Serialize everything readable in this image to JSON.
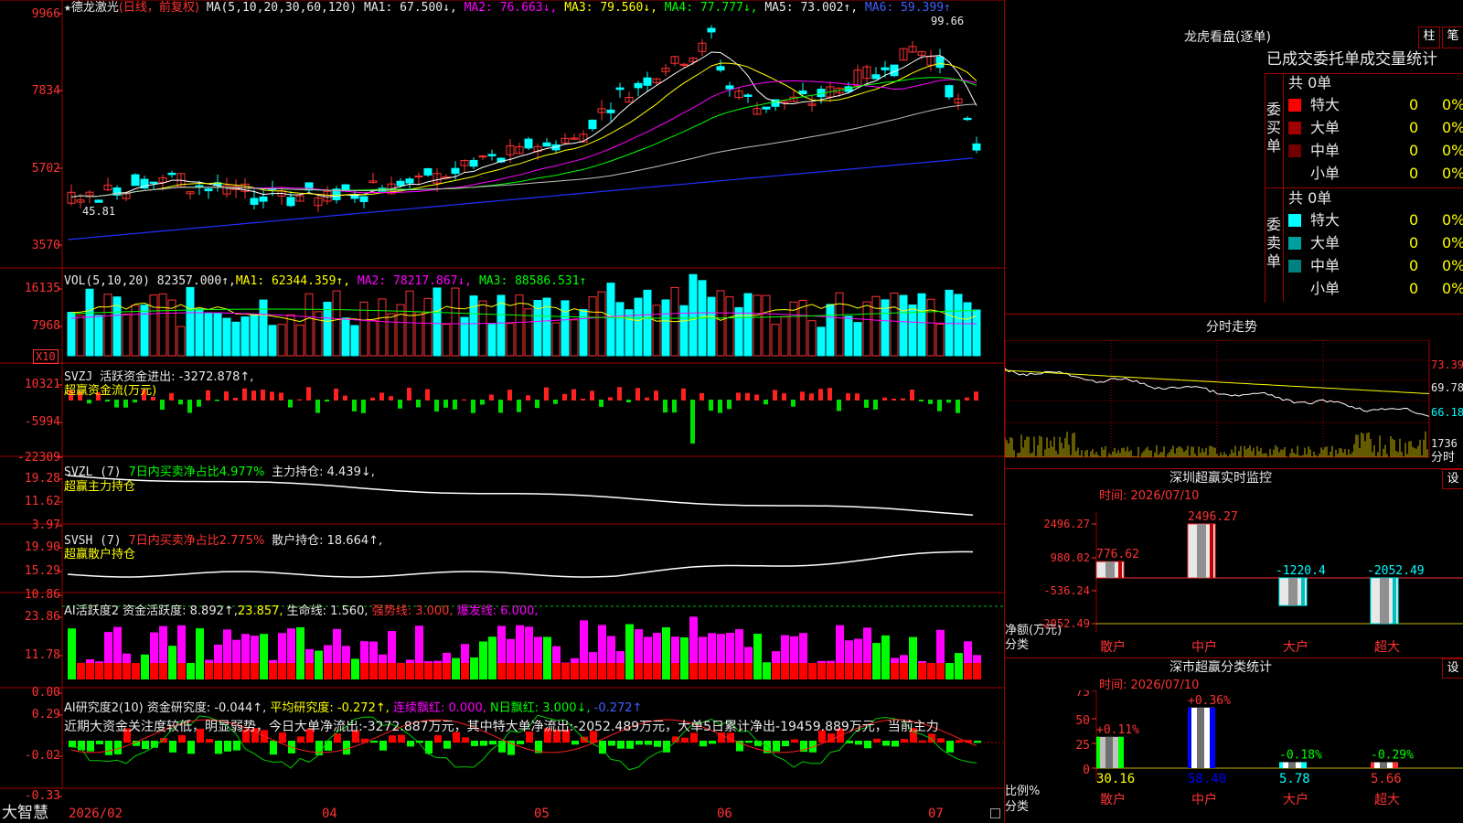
{
  "stock": {
    "star": "★",
    "name": "德龙激光",
    "mode": "(日线，前复权)"
  },
  "main_chart": {
    "ma_params": "MA(5,10,20,30,60,120)",
    "ma1": "MA1: 67.500↓,",
    "ma2": "MA2: 76.663↓,",
    "ma3": "MA3: 79.560↓,",
    "ma4": "MA4: 77.777↓,",
    "ma5": "MA5: 73.002↑,",
    "ma6": "MA6: 59.399↑",
    "y_ticks": [
      "9966",
      "7834",
      "5702",
      "3570"
    ],
    "high_label": "99.66",
    "low_label": "45.81"
  },
  "vol_chart": {
    "title": "VOL(5,10,20)",
    "value": "82357.000↑,",
    "ma1": "MA1: 62344.359↑,",
    "ma2": "MA2: 78217.867↓,",
    "ma3": "MA3: 88586.531↑",
    "y_ticks": [
      "16135",
      "7968"
    ],
    "unit": "X10"
  },
  "svzj": {
    "title": "SVZJ",
    "label": "活跃资金进出: -3272.878↑,",
    "label2": "超赢资金流(万元)",
    "y_ticks": [
      "10321",
      "-5994",
      "-22309"
    ]
  },
  "svzl": {
    "title": "SVZL (7)",
    "label_green": "7日内买卖净占比4.977%",
    "label": "主力持仓: 4.439↓,",
    "label2": "超赢主力持仓",
    "y_ticks": [
      "19.28",
      "11.62",
      "3.97"
    ]
  },
  "svsh": {
    "title": "SVSH (7)",
    "label_red": "7日内买卖净占比2.775%",
    "label": "散户持仓: 18.664↑,",
    "label2": "超赢散户持仓",
    "y_ticks": [
      "19.90",
      "15.29",
      "10.86"
    ]
  },
  "ai_active": {
    "title": "AI活跃度2",
    "label1": "资金活跃度: 8.892↑,",
    "label2": "23.857,",
    "label3": "生命线: 1.560,",
    "label4": "强势线: 3.000,",
    "label5": "爆发线: 6.000,",
    "y_ticks": [
      "23.86",
      "11.78",
      "0.00"
    ]
  },
  "ai_research": {
    "title": "AI研究度2(10)",
    "label1": "资金研究度: -0.044↑,",
    "label2": "平均研究度: -0.272↑,",
    "label3": "连续飘红: 0.000,",
    "label4": "N日飘红: 3.000↓,",
    "label5": "-0.272↑",
    "comment": "近期大资金关注度较低，明显弱势，今日大单净流出:-3272.887万元，其中特大单净流出:-2052.489万元，大单5日累计净出-19459.889万元，当前主力",
    "y_ticks": [
      "0.29",
      "-0.02",
      "-0.33"
    ]
  },
  "x_axis": {
    "brand": "大智慧",
    "labels": [
      "2026/02",
      "04",
      "05",
      "06",
      "07"
    ]
  },
  "dragon": {
    "title": "龙虎看盘(逐单)",
    "btn1": "柱",
    "btn2": "笔",
    "header": "已成交委托单成交量统计",
    "buy_label": "委买单",
    "sell_label": "委卖单",
    "buy_total": "共 0单",
    "sell_total": "共 0单",
    "buy_rows": [
      {
        "name": "特大",
        "count": "0",
        "pct": "0%",
        "color": "#ff0000"
      },
      {
        "name": "大单",
        "count": "0",
        "pct": "0%",
        "color": "#a00000"
      },
      {
        "name": "中单",
        "count": "0",
        "pct": "0%",
        "color": "#700000"
      },
      {
        "name": "小单",
        "count": "0",
        "pct": "0%",
        "color": "#000000"
      }
    ],
    "sell_rows": [
      {
        "name": "特大",
        "count": "0",
        "pct": "0%",
        "color": "#00ffff"
      },
      {
        "name": "大单",
        "count": "0",
        "pct": "0%",
        "color": "#00a0a0"
      },
      {
        "name": "中单",
        "count": "0",
        "pct": "0%",
        "color": "#008080"
      },
      {
        "name": "小单",
        "count": "0",
        "pct": "0%",
        "color": "#000000"
      }
    ]
  },
  "intraday": {
    "title": "分时走势",
    "y_ticks": [
      "73.39",
      "69.78",
      "66.18"
    ],
    "vol_tick": "1736",
    "vol_unit": "分时"
  },
  "sz_monitor": {
    "title": "深圳超赢实时监控",
    "btn": "设",
    "time": "时间: 2026/07/10",
    "y_ticks": [
      "2496.27",
      "980.02",
      "-536.24",
      "-2052.49"
    ],
    "y_label": "净额(万元)",
    "x_label": "分类",
    "bars": [
      {
        "cat": "散户",
        "value_label": "776.62",
        "color": "red"
      },
      {
        "cat": "中户",
        "value_label": "2496.27",
        "color": "red"
      },
      {
        "cat": "大户",
        "value_label": "-1220.4",
        "color": "cyan"
      },
      {
        "cat": "超大",
        "value_label": "-2052.49",
        "color": "cyan"
      }
    ]
  },
  "sz_class": {
    "title": "深市超赢分类统计",
    "btn": "设",
    "time": "时间: 2026/07/10",
    "y_ticks": [
      "75",
      "50",
      "25",
      "0"
    ],
    "y_label": "比例%",
    "x_label": "分类",
    "bars": [
      {
        "cat": "散户",
        "pct": "30.16",
        "delta": "+0.11%"
      },
      {
        "cat": "中户",
        "pct": "58.40",
        "delta": "+0.36%"
      },
      {
        "cat": "大户",
        "pct": "5.78",
        "delta": "-0.18%"
      },
      {
        "cat": "超大",
        "pct": "5.66",
        "delta": "-0.29%"
      }
    ]
  },
  "chart_data": {
    "type": "candlestick",
    "sz_monitor_values": [
      776.62,
      2496.27,
      -1220.4,
      -2052.49
    ],
    "sz_class_values": [
      30.16,
      58.4,
      5.78,
      5.66
    ]
  }
}
